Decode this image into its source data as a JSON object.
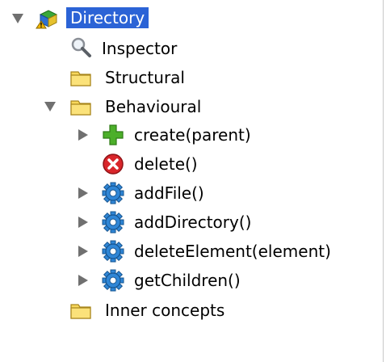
{
  "tree": {
    "root": {
      "label": "Directory",
      "icon": "directory-concept-icon",
      "expanded": true,
      "selected": true
    },
    "items": [
      {
        "label": "Inspector",
        "icon": "magnifier-icon"
      },
      {
        "label": "Structural",
        "icon": "folder-icon"
      },
      {
        "label": "Behavioural",
        "icon": "folder-icon",
        "expanded": true,
        "children": [
          {
            "label": "create(parent)",
            "icon": "plus-icon"
          },
          {
            "label": "delete()",
            "icon": "delete-icon"
          },
          {
            "label": "addFile()",
            "icon": "gear-icon"
          },
          {
            "label": "addDirectory()",
            "icon": "gear-icon"
          },
          {
            "label": "deleteElement(element)",
            "icon": "gear-icon"
          },
          {
            "label": "getChildren()",
            "icon": "gear-icon"
          }
        ]
      },
      {
        "label": "Inner concepts",
        "icon": "folder-icon"
      }
    ]
  },
  "colors": {
    "selection": "#2b63d6",
    "folder": "#f7d75b",
    "plus": "#4caf2a",
    "delete": "#d9262b",
    "gear": "#2f86d6"
  }
}
